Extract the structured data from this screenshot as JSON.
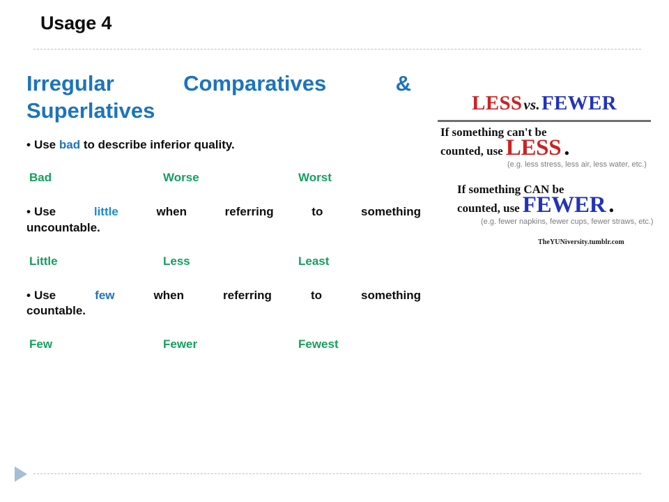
{
  "slide": {
    "title": "Usage 4",
    "heading_line1": "Irregular Comparatives &",
    "heading_line2": "Superlatives",
    "accent_blue": "#1C74BC",
    "accent_green": "#14A05E"
  },
  "rules": [
    {
      "bullet": "•",
      "text_before": "Use ",
      "keyword": "bad",
      "text_after": " to describe inferior quality.",
      "forms": {
        "base": "Bad",
        "comparative": "Worse",
        "superlative": "Worst"
      }
    },
    {
      "bullet": "•",
      "text_before": "Use ",
      "keyword": "little",
      "text_after_line1": " when referring to something",
      "text_after_line2": "uncountable.",
      "forms": {
        "base": "Little",
        "comparative": "Less",
        "superlative": "Least"
      }
    },
    {
      "bullet": "•",
      "text_before": "Use ",
      "keyword": "few",
      "text_after_line1": " when referring to something",
      "text_after_line2": "countable.",
      "forms": {
        "base": "Few",
        "comparative": "Fewer",
        "superlative": "Fewest"
      }
    }
  ],
  "poster": {
    "title_less": "LESS",
    "title_vs": "vs.",
    "title_fewer": "FEWER",
    "block1_line1": "If something can't be",
    "block1_line2": "counted, use",
    "block1_bigword": "LESS",
    "block1_period": ".",
    "block1_examples": "(e.g. less stress, less air, less water, etc.)",
    "block2_line1": "If something CAN be",
    "block2_line2": "counted, use",
    "block2_bigword": "FEWER",
    "block2_period": ".",
    "block2_examples": "(e.g. fewer napkins, fewer cups, fewer straws, etc.)",
    "credit": "TheYUNiversity.tumblr.com",
    "color_red": "#CC2222",
    "color_blue": "#2233BB"
  },
  "footer": {
    "next_arrow": "next-slide-arrow"
  }
}
